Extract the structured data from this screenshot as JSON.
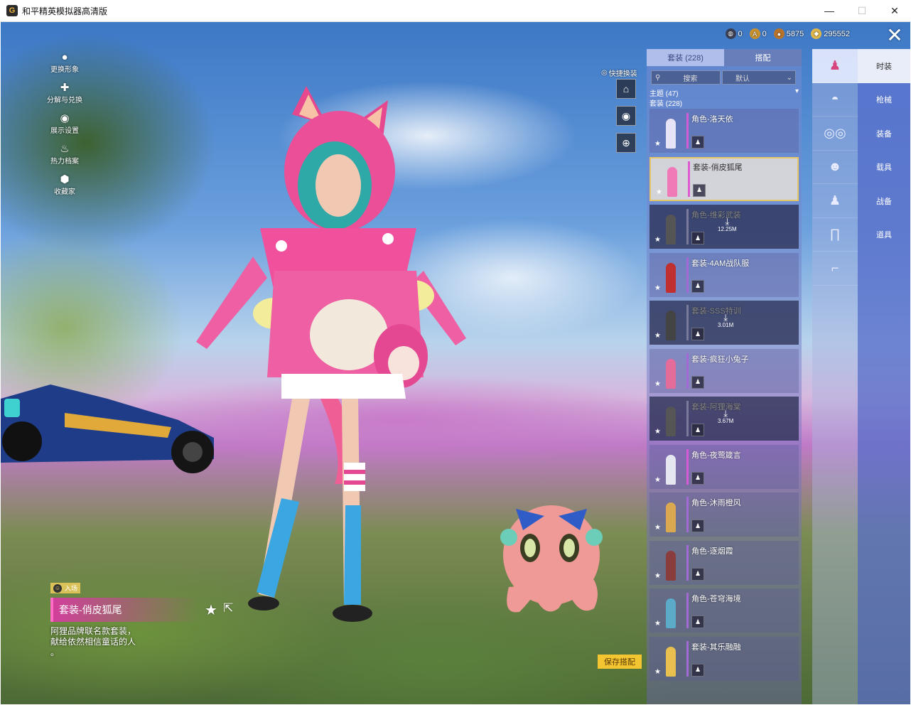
{
  "window": {
    "title": "和平精英模拟器高清版",
    "app_icon": "G",
    "controls": [
      "minimize-icon",
      "maximize-icon",
      "close-icon"
    ]
  },
  "currency": [
    {
      "icon": "globe-coin-icon",
      "value": "0",
      "color": "#3a3f55"
    },
    {
      "icon": "gold-a-coin-icon",
      "value": "0",
      "color": "#c9922f"
    },
    {
      "icon": "bronze-coin-icon",
      "value": "5875",
      "color": "#b8732b"
    },
    {
      "icon": "diamond-coin-icon",
      "value": "295552",
      "color": "#e0b84a"
    }
  ],
  "left_menu": [
    {
      "label": "更换形象",
      "icon": "person-icon"
    },
    {
      "label": "分解与兑换",
      "icon": "puzzle-icon"
    },
    {
      "label": "展示设置",
      "icon": "eye-icon"
    },
    {
      "label": "热力档案",
      "icon": "flame-icon"
    },
    {
      "label": "收藏家",
      "icon": "collector-badge-icon"
    }
  ],
  "quick_change": {
    "label": "快捷换装",
    "tools": [
      "wardrobe-icon",
      "emblem-icon",
      "add-outfit-icon"
    ]
  },
  "panel": {
    "tabs": [
      {
        "label": "套装 (228)",
        "active": true
      },
      {
        "label": "搭配",
        "active": false
      }
    ],
    "search_placeholder": "搜索",
    "sort": "默认",
    "theme_line": "主题 (47)",
    "set_line": "套装 (228)",
    "items": [
      {
        "name": "角色-洛天依",
        "state": "normal",
        "rarity_color": "#d55ad6",
        "fig_color": "#e8e4f8"
      },
      {
        "name": "套装-俏皮狐尾",
        "state": "selected",
        "rarity_color": "#e05ad0",
        "fig_color": "#f07ab8"
      },
      {
        "name": "角色-维彩武装",
        "state": "download",
        "size": "12.25M",
        "rarity_color": "#7a7a9a",
        "fig_color": "#555"
      },
      {
        "name": "套装-4AM战队服",
        "state": "normal",
        "rarity_color": "#a36ad6",
        "fig_color": "#c03030"
      },
      {
        "name": "套装-SSS特训",
        "state": "download",
        "size": "3.01M",
        "rarity_color": "#7a7a9a",
        "fig_color": "#444"
      },
      {
        "name": "套装-疯狂小兔子",
        "state": "normal",
        "rarity_color": "#a36ad6",
        "fig_color": "#e46c9a"
      },
      {
        "name": "套装-阿狸海棠",
        "state": "download",
        "size": "3.67M",
        "rarity_color": "#7a7a9a",
        "fig_color": "#555"
      },
      {
        "name": "角色-夜莺箴言",
        "state": "normal",
        "rarity_color": "#d55ad6",
        "fig_color": "#e6e6f0"
      },
      {
        "name": "角色-沐雨橙风",
        "state": "normal",
        "rarity_color": "#a36ad6",
        "fig_color": "#d9a850"
      },
      {
        "name": "角色-逐烟霞",
        "state": "normal",
        "rarity_color": "#a36ad6",
        "fig_color": "#8a3d3d"
      },
      {
        "name": "角色-苍穹海境",
        "state": "normal",
        "rarity_color": "#a36ad6",
        "fig_color": "#5aaac8"
      },
      {
        "name": "套装-其乐融融",
        "state": "normal",
        "rarity_color": "#a36ad6",
        "fig_color": "#e9c050"
      }
    ]
  },
  "category_icons": [
    "character-icon",
    "cap-icon",
    "glasses-icon",
    "mask-icon",
    "outfit-icon",
    "pants-icon",
    "socks-icon"
  ],
  "main_categories": [
    {
      "label": "时装",
      "active": true
    },
    {
      "label": "枪械",
      "active": false
    },
    {
      "label": "装备",
      "active": false
    },
    {
      "label": "载具",
      "active": false
    },
    {
      "label": "战备",
      "active": false
    },
    {
      "label": "道具",
      "active": false
    }
  ],
  "info": {
    "badge": "入场",
    "title": "套装-俏皮狐尾",
    "desc_line1": "阿狸品牌联名款套装，",
    "desc_line2": "献给依然相信童话的人",
    "desc_line3": "。"
  },
  "save_button": "保存搭配"
}
